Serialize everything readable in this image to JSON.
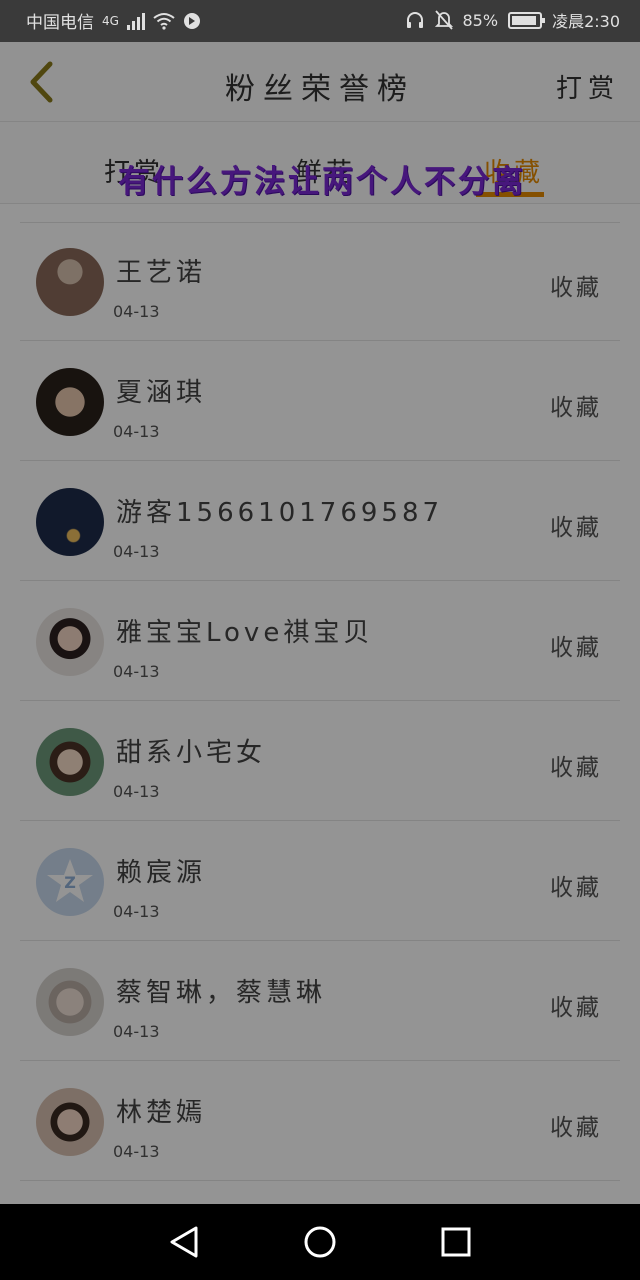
{
  "statusbar": {
    "left_text": "中国电信",
    "network": "4G",
    "battery": "85%",
    "time": "凌晨2:30"
  },
  "header": {
    "title": "粉丝荣誉榜",
    "reward": "打赏"
  },
  "tabs": [
    {
      "label": "打赏"
    },
    {
      "label": "鲜花"
    },
    {
      "label": "收藏",
      "active": true
    }
  ],
  "overlay": "有什么方法让两个人不分离",
  "list": [
    {
      "name": "王艺诺",
      "date": "04-13",
      "action": "收藏",
      "avatar_color": "#8a6a5a"
    },
    {
      "name": "夏涵琪",
      "date": "04-13",
      "action": "收藏",
      "avatar_color": "#5b4636"
    },
    {
      "name": "游客1566101769587",
      "date": "04-13",
      "action": "收藏",
      "avatar_color": "#1e2c4a"
    },
    {
      "name": "雅宝宝Love祺宝贝",
      "date": "04-13",
      "action": "收藏",
      "avatar_color": "#c9c0b8"
    },
    {
      "name": "甜系小宅女",
      "date": "04-13",
      "action": "收藏",
      "avatar_color": "#6d9a7a"
    },
    {
      "name": "赖宸源",
      "date": "04-13",
      "action": "收藏",
      "avatar_color": "#c8d9ee"
    },
    {
      "name": "蔡智琳，蔡慧琳",
      "date": "04-13",
      "action": "收藏",
      "avatar_color": "#d6d2ce"
    },
    {
      "name": "林楚嫣",
      "date": "04-13",
      "action": "收藏",
      "avatar_color": "#d8c0b0"
    }
  ],
  "colors": {
    "accent": "#e58a00",
    "overlay_text": "#7a28d6"
  }
}
